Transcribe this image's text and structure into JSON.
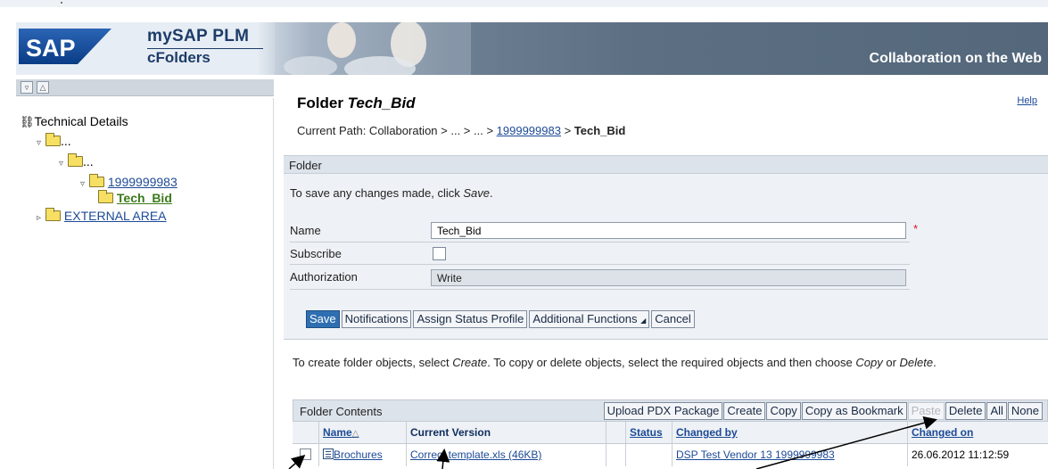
{
  "banner": {
    "logo": "SAP",
    "product_line1": "mySAP PLM",
    "product_line2": "cFolders",
    "tagline": "Collaboration on the Web"
  },
  "tree": {
    "toolbar": [
      "expand-all-icon",
      "collapse-all-icon"
    ],
    "root": "Technical Details",
    "items": [
      {
        "label": "...",
        "level": 1,
        "type": "ellipsis"
      },
      {
        "label": "...",
        "level": 2,
        "type": "ellipsis"
      },
      {
        "label": "1999999983",
        "level": 3,
        "type": "link"
      },
      {
        "label": "Tech_Bid",
        "level": 4,
        "type": "current"
      },
      {
        "label": "EXTERNAL AREA",
        "level": 1,
        "type": "link"
      }
    ]
  },
  "page": {
    "title_prefix": "Folder ",
    "title_name": "Tech_Bid",
    "help": "Help",
    "path_label": "Current Path:  Collaboration > ... > ... > ",
    "path_link": "1999999983",
    "path_sep": " > ",
    "path_current": "Tech_Bid"
  },
  "folder": {
    "header": "Folder",
    "save_hint_prefix": "To save any changes made, click ",
    "save_hint_em": "Save",
    "save_hint_suffix": ".",
    "name_label": "Name",
    "name_value": "Tech_Bid",
    "required_mark": "*",
    "subscribe_label": "Subscribe",
    "subscribe_checked": false,
    "authorization_label": "Authorization",
    "authorization_value": "Write",
    "buttons": {
      "save": "Save",
      "notifications": "Notifications",
      "assign_status": "Assign Status Profile",
      "additional": "Additional Functions",
      "cancel": "Cancel"
    }
  },
  "instructions": {
    "p1": "To create folder objects, select ",
    "create": "Create",
    "p2": ". To copy or delete objects, select the required objects and then choose ",
    "copy": "Copy",
    "p3": " or ",
    "delete": "Delete",
    "p4": "."
  },
  "contents": {
    "title": "Folder Contents",
    "buttons": {
      "upload": "Upload PDX Package",
      "create": "Create",
      "copy": "Copy",
      "copy_bookmark": "Copy as Bookmark",
      "paste": "Paste",
      "delete": "Delete",
      "all": "All",
      "none": "None"
    },
    "columns": {
      "name": "Name",
      "sort_indicator": "△",
      "current_version": "Current Version",
      "blank": "",
      "status": "Status",
      "changed_by": "Changed by",
      "changed_on": "Changed on"
    },
    "rows": [
      {
        "name": "Brochures",
        "current_version": "Correct template.xls (46KB)",
        "status": "",
        "changed_by": "DSP Test Vendor 13 1999999983",
        "changed_on": "26.06.2012 11:12:59"
      }
    ]
  },
  "colors": {
    "link": "#1c4a96",
    "primary_button": "#2f6fb1",
    "header_blue": "#1d3c68",
    "current_tree_item": "#3a7a1a"
  }
}
